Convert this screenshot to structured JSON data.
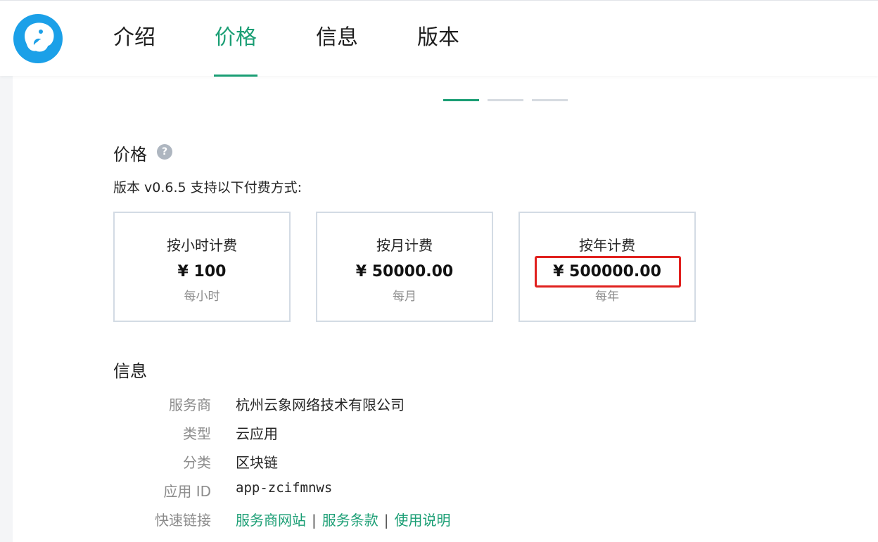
{
  "nav": {
    "tabs": [
      {
        "label": "介绍"
      },
      {
        "label": "价格",
        "active": true
      },
      {
        "label": "信息"
      },
      {
        "label": "版本"
      }
    ]
  },
  "pricing": {
    "title": "价格",
    "help_icon": "?",
    "description": "版本 v0.6.5 支持以下付费方式:",
    "plans": [
      {
        "name": "按小时计费",
        "price": "¥ 100",
        "unit": "每小时"
      },
      {
        "name": "按月计费",
        "price": "¥ 50000.00",
        "unit": "每月"
      },
      {
        "name": "按年计费",
        "price": "¥ 500000.00",
        "unit": "每年",
        "highlighted": true
      }
    ]
  },
  "info": {
    "title": "信息",
    "rows": [
      {
        "label": "服务商",
        "value": "杭州云象网络技术有限公司"
      },
      {
        "label": "类型",
        "value": "云应用"
      },
      {
        "label": "分类",
        "value": "区块链"
      },
      {
        "label": "应用 ID",
        "value": "app-zcifmnws"
      }
    ],
    "links_label": "快速链接",
    "links": [
      "服务商网站",
      "服务条款",
      "使用说明"
    ],
    "separator": "|"
  },
  "colors": {
    "accent": "#1a9e74",
    "highlight_border": "#e0201e",
    "logo_blue": "#1ba0e8"
  },
  "icons": {
    "logo": "elephant-logo-icon",
    "help": "question-help-icon"
  }
}
